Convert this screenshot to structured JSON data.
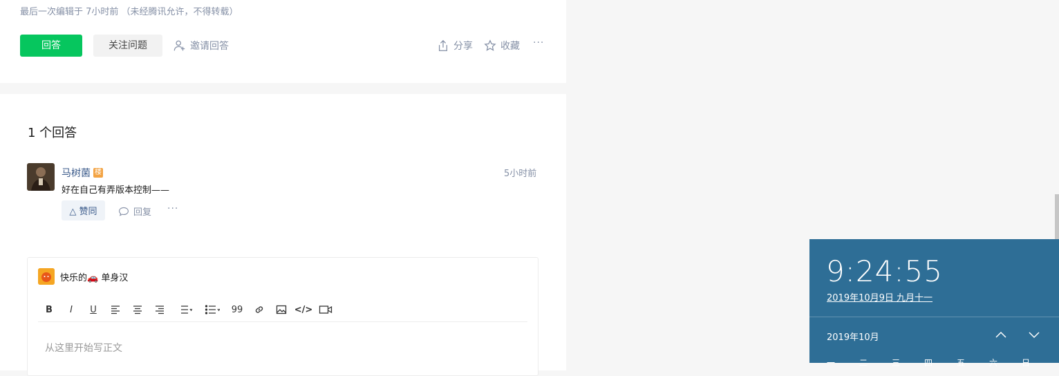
{
  "question": {
    "meta": "最后一次编辑于  7小时前   （未经腾讯允许，不得转载）",
    "answer_button": "回答",
    "follow_button": "关注问题",
    "invite_label": "邀请回答",
    "share_label": "分享",
    "collect_label": "收藏",
    "more": "···"
  },
  "answers": {
    "title": "1 个回答",
    "items": [
      {
        "author": "马树菌",
        "badge": "楼",
        "time": "5小时前",
        "content": "好在自己有弄版本控制——",
        "vote_label": "△ 赞同",
        "reply_label": "回复",
        "more": "···"
      }
    ]
  },
  "editor": {
    "username": "快乐的🚗 单身汉",
    "placeholder": "从这里开始写正文",
    "toolbar": [
      {
        "name": "bold",
        "glyph": "B"
      },
      {
        "name": "italic",
        "glyph": "I"
      },
      {
        "name": "underline",
        "glyph": "U"
      },
      {
        "name": "align-left",
        "glyph": ""
      },
      {
        "name": "align-center",
        "glyph": ""
      },
      {
        "name": "align-right",
        "glyph": ""
      },
      {
        "name": "ordered-list",
        "glyph": ""
      },
      {
        "name": "unordered-list",
        "glyph": ""
      },
      {
        "name": "quote",
        "glyph": "99"
      },
      {
        "name": "link",
        "glyph": ""
      },
      {
        "name": "image",
        "glyph": ""
      },
      {
        "name": "code",
        "glyph": "</>"
      },
      {
        "name": "video",
        "glyph": ""
      }
    ]
  },
  "clock": {
    "time": "9:24:55",
    "date": "2019年10月9日 九月十一",
    "month": "2019年10月",
    "weekdays": [
      "一",
      "二",
      "三",
      "四",
      "五",
      "六",
      "日"
    ]
  },
  "colors": {
    "primary": "#06c65e",
    "clock_bg": "#2e6e96",
    "link": "#3a5a8a"
  }
}
